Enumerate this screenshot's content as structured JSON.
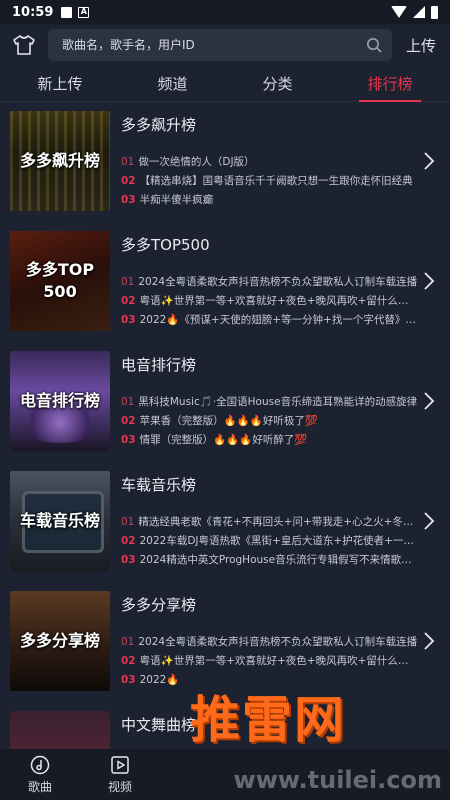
{
  "status": {
    "time": "10:59"
  },
  "search": {
    "placeholder": "歌曲名，歌手名，用户ID",
    "upload_label": "上传"
  },
  "tabs": [
    {
      "label": "新上传"
    },
    {
      "label": "频道"
    },
    {
      "label": "分类"
    },
    {
      "label": "排行榜",
      "active": true
    }
  ],
  "charts": [
    {
      "title": "多多飙升榜",
      "cover_text": "多多飙升榜",
      "tracks": [
        {
          "num": "01",
          "text": "做一次绝情的人（DJ版）"
        },
        {
          "num": "02",
          "text": "【精选串烧】国粤语音乐千千阙歌只想一生跟你走怀旧经典"
        },
        {
          "num": "03",
          "text": "半痴半傻半疯癫"
        }
      ]
    },
    {
      "title": "多多TOP500",
      "cover_text": "多多TOP\n500",
      "tracks": [
        {
          "num": "01",
          "text": "2024全粤语柔歌女声抖音热榜不负众望歌私人订制车载连播"
        },
        {
          "num": "02",
          "text": "粤语✨世界第一等+欢喜就好+夜色+晚风再吹+留什么给你"
        },
        {
          "num": "03",
          "text": "2022🔥《预谋+天使的翅膀+等一分钟+找一个字代替》Dj版"
        }
      ]
    },
    {
      "title": "电音排行榜",
      "cover_text": "电音排行榜",
      "tracks": [
        {
          "num": "01",
          "text": "黑科技Music🎵·全国语House音乐缔造耳熟能详的动感旋律"
        },
        {
          "num": "02",
          "text": "苹果香（完整版）🔥🔥🔥好听极了💯"
        },
        {
          "num": "03",
          "text": "情罪（完整版）🔥🔥🔥好听醉了💯"
        }
      ]
    },
    {
      "title": "车载音乐榜",
      "cover_text": "车载音乐榜",
      "tracks": [
        {
          "num": "01",
          "text": "精选经典老歌《青花+不再回头+问+带我走+心之火+冬眠》"
        },
        {
          "num": "02",
          "text": "2022车载DJ粤语热歌《黑街+皇后大道东+护花使者+一切随风》"
        },
        {
          "num": "03",
          "text": "2024精选中英文ProgHouse音乐流行专辑假写不来情歌Bass"
        }
      ]
    },
    {
      "title": "多多分享榜",
      "cover_text": "多多分享榜",
      "tracks": [
        {
          "num": "01",
          "text": "2024全粤语柔歌女声抖音热榜不负众望歌私人订制车载连播"
        },
        {
          "num": "02",
          "text": "粤语✨世界第一等+欢喜就好+夜色+晚风再吹+留什么给你"
        },
        {
          "num": "03",
          "text": "2022🔥"
        }
      ]
    },
    {
      "title": "中文舞曲榜",
      "cover_text": "",
      "tracks": []
    }
  ],
  "bottom_nav": [
    {
      "label": "歌曲",
      "icon": "disc-icon"
    },
    {
      "label": "视频",
      "icon": "video-icon"
    }
  ],
  "watermark": {
    "big": "推雷网",
    "small": "www.tuilei.com"
  }
}
